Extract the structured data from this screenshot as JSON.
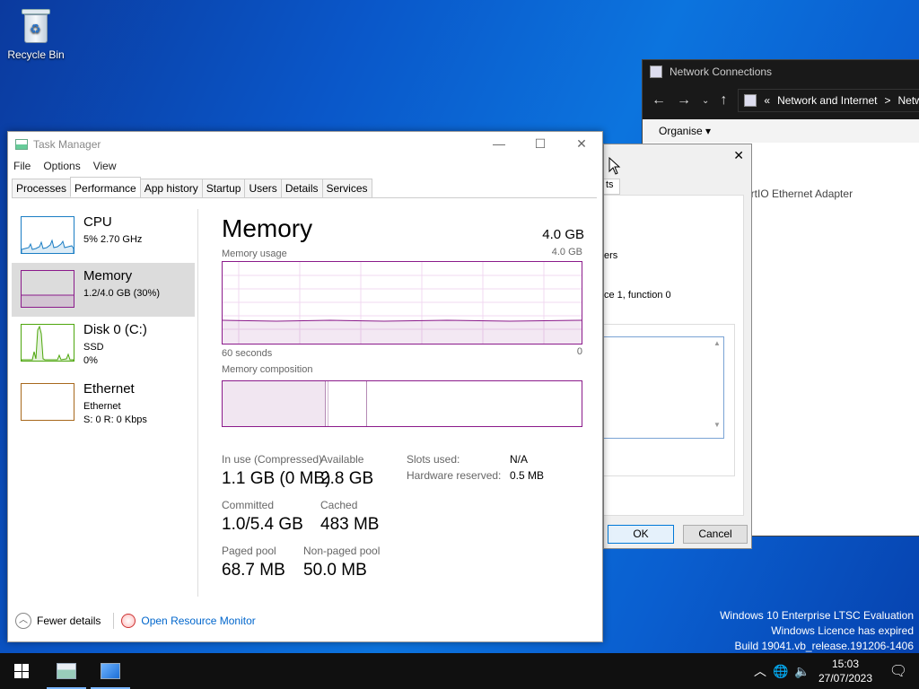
{
  "desktop": {
    "recycle_bin": "Recycle Bin"
  },
  "network_window": {
    "title": "Network Connections",
    "breadcrumb_prefix": "«",
    "breadcrumb_1": "Network and Internet",
    "breadcrumb_sep": ">",
    "breadcrumb_2": "Netw",
    "organise": "Organise ▾",
    "adapter_text": "irtIO Ethernet Adapter"
  },
  "properties_dialog": {
    "tab_fragment": "ts",
    "text_1": "ers",
    "text_2": "ce 1, function 0",
    "ok": "OK",
    "cancel": "Cancel"
  },
  "task_manager": {
    "title": "Task Manager",
    "menu": [
      "File",
      "Options",
      "View"
    ],
    "tabs": [
      "Processes",
      "Performance",
      "App history",
      "Startup",
      "Users",
      "Details",
      "Services"
    ],
    "active_tab": "Performance",
    "resources": [
      {
        "name": "CPU",
        "sub1": "5% 2.70 GHz",
        "sub2": "",
        "color": "#1a7dc4"
      },
      {
        "name": "Memory",
        "sub1": "1.2/4.0 GB (30%)",
        "sub2": "",
        "color": "#8b1a8b"
      },
      {
        "name": "Disk 0 (C:)",
        "sub1": "SSD",
        "sub2": "0%",
        "color": "#4da60c"
      },
      {
        "name": "Ethernet",
        "sub1": "Ethernet",
        "sub2": "S: 0 R: 0 Kbps",
        "color": "#a7681c"
      }
    ],
    "panel": {
      "title": "Memory",
      "total": "4.0 GB",
      "usage_label": "Memory usage",
      "usage_max": "4.0 GB",
      "time_left": "60 seconds",
      "time_right": "0",
      "composition_label": "Memory composition",
      "in_use_label": "In use (Compressed)",
      "in_use_value": "1.1 GB (0 MB)",
      "available_label": "Available",
      "available_value": "2.8 GB",
      "slots_label": "Slots used:",
      "slots_value": "N/A",
      "hw_label": "Hardware reserved:",
      "hw_value": "0.5 MB",
      "committed_label": "Committed",
      "committed_value": "1.0/5.4 GB",
      "cached_label": "Cached",
      "cached_value": "483 MB",
      "paged_label": "Paged pool",
      "paged_value": "68.7 MB",
      "nonpaged_label": "Non-paged pool",
      "nonpaged_value": "50.0 MB"
    },
    "footer": {
      "fewer_details": "Fewer details",
      "resource_monitor": "Open Resource Monitor"
    }
  },
  "watermark": {
    "line1": "Windows 10 Enterprise LTSC Evaluation",
    "line2": "Windows Licence has expired",
    "line3": "Build 19041.vb_release.191206-1406"
  },
  "taskbar": {
    "time": "15:03",
    "date": "27/07/2023"
  }
}
